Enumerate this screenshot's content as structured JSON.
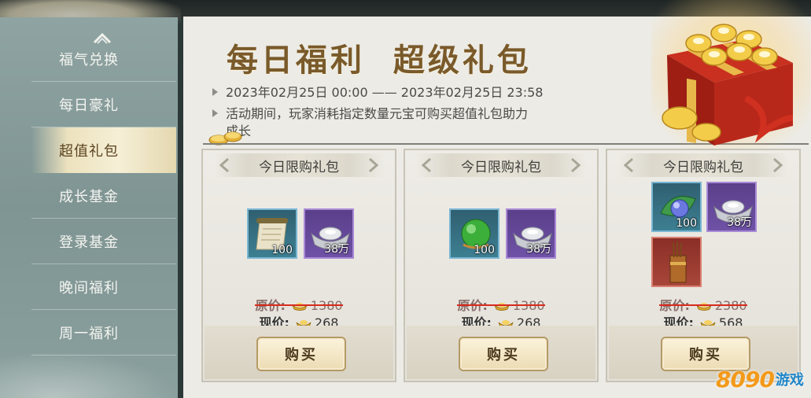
{
  "sidebar": {
    "items": [
      {
        "label": "福气兑换",
        "active": false
      },
      {
        "label": "每日豪礼",
        "active": false
      },
      {
        "label": "超值礼包",
        "active": true
      },
      {
        "label": "成长基金",
        "active": false
      },
      {
        "label": "登录基金",
        "active": false
      },
      {
        "label": "晚间福利",
        "active": false
      },
      {
        "label": "周一福利",
        "active": false
      }
    ]
  },
  "header": {
    "title": "每日福利 超级礼包",
    "period": "2023年02月25日 00:00 —— 2023年02月25日 23:58",
    "description_line1": "活动期间，玩家消耗指定数量元宝可购买超值礼包助力",
    "description_line2": "成长"
  },
  "cards": [
    {
      "header": "今日限购礼包",
      "items": [
        {
          "icon": "scroll-icon",
          "count": "100",
          "rarity": "blue"
        },
        {
          "icon": "silver-ingot-icon",
          "count": "38万",
          "rarity": "purple"
        }
      ],
      "original_label": "原价:",
      "original_price": "1380",
      "current_label": "现价:",
      "current_price": "268",
      "buy_label": "购买"
    },
    {
      "header": "今日限购礼包",
      "items": [
        {
          "icon": "green-orb-icon",
          "count": "100",
          "rarity": "blue"
        },
        {
          "icon": "silver-ingot-icon",
          "count": "38万",
          "rarity": "purple"
        }
      ],
      "original_label": "原价:",
      "original_price": "1380",
      "current_label": "现价:",
      "current_price": "268",
      "buy_label": "购买"
    },
    {
      "header": "今日限购礼包",
      "items": [
        {
          "icon": "blue-orb-leaf-icon",
          "count": "100",
          "rarity": "blue"
        },
        {
          "icon": "silver-ingot-icon",
          "count": "38万",
          "rarity": "purple"
        },
        {
          "icon": "incense-bundle-icon",
          "count": "",
          "rarity": "red"
        }
      ],
      "original_label": "原价:",
      "original_price": "2380",
      "current_label": "现价:",
      "current_price": "568",
      "buy_label": "购买"
    }
  ],
  "watermark": {
    "number": "8090",
    "text": "游戏"
  },
  "colors": {
    "title": "#7a5a2a",
    "strike": "#d92a1e",
    "gold": "#f0c23a",
    "sidebar_active": "#f6efd6"
  }
}
